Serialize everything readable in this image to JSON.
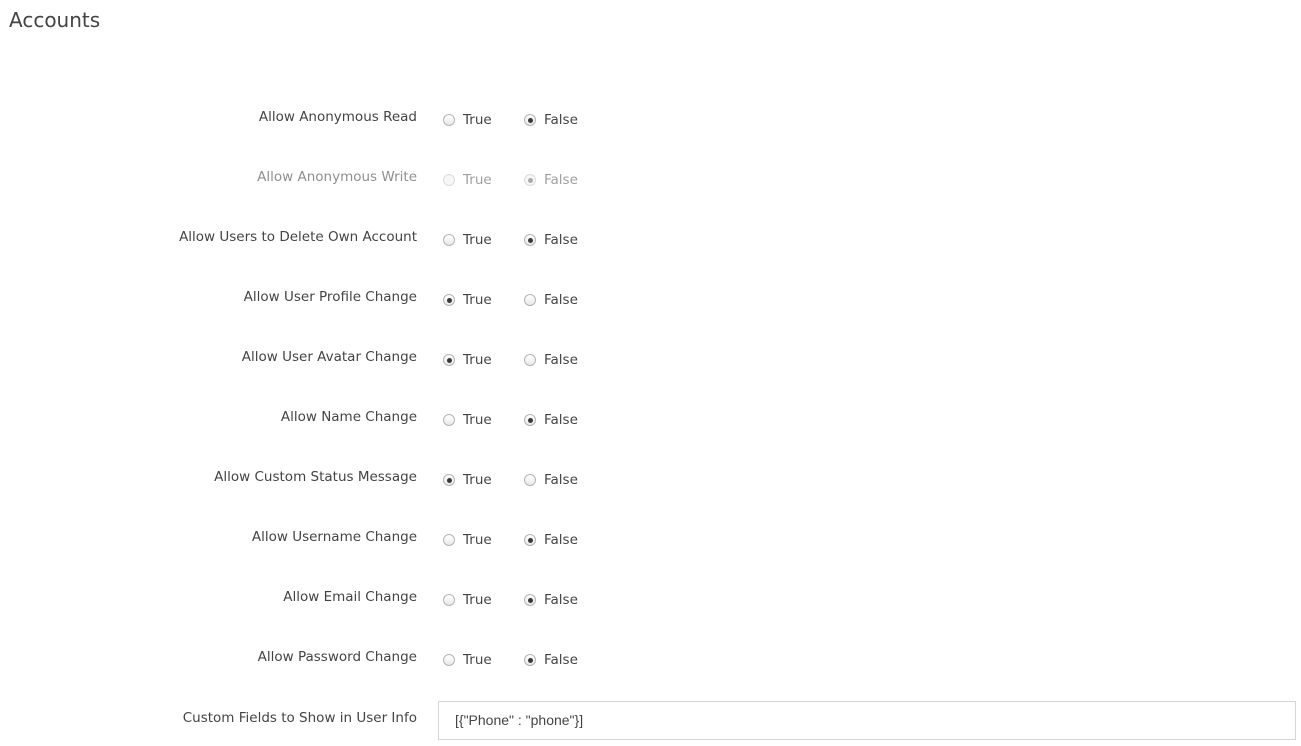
{
  "page": {
    "title": "Accounts"
  },
  "options": {
    "true_label": "True",
    "false_label": "False"
  },
  "settings": [
    {
      "label": "Allow Anonymous Read",
      "value": "False",
      "disabled": false
    },
    {
      "label": "Allow Anonymous Write",
      "value": "False",
      "disabled": true
    },
    {
      "label": "Allow Users to Delete Own Account",
      "value": "False",
      "disabled": false
    },
    {
      "label": "Allow User Profile Change",
      "value": "True",
      "disabled": false
    },
    {
      "label": "Allow User Avatar Change",
      "value": "True",
      "disabled": false
    },
    {
      "label": "Allow Name Change",
      "value": "False",
      "disabled": false
    },
    {
      "label": "Allow Custom Status Message",
      "value": "True",
      "disabled": false
    },
    {
      "label": "Allow Username Change",
      "value": "False",
      "disabled": false
    },
    {
      "label": "Allow Email Change",
      "value": "False",
      "disabled": false
    },
    {
      "label": "Allow Password Change",
      "value": "False",
      "disabled": false
    }
  ],
  "custom_fields": {
    "label": "Custom Fields to Show in User Info",
    "value": "[{\"Phone\" : \"phone\"}]"
  }
}
